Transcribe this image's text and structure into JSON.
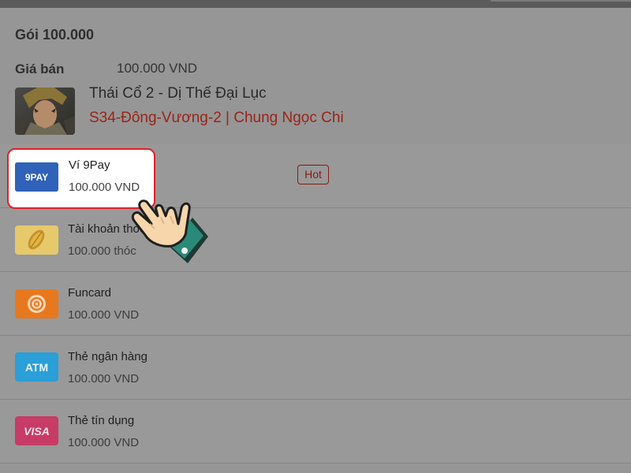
{
  "package": {
    "title": "Gói 100.000",
    "price_label": "Giá bán",
    "price_value": "100.000 VND"
  },
  "game": {
    "name": "Thái Cổ 2 - Dị Thế Đại Lục",
    "server": "S34-Đông-Vương-2 | Chung Ngọc Chi"
  },
  "methods": [
    {
      "name": "Ví 9Pay",
      "amount": "100.000 VND",
      "icon": "9pay-logo-icon",
      "logo_text": "9PAY",
      "badge": "Hot",
      "highlighted": true
    },
    {
      "name": "Tài khoản thóc",
      "amount": "100.000 thóc",
      "icon": "rice-grain-icon"
    },
    {
      "name": "Funcard",
      "amount": "100.000 VND",
      "icon": "funcard-swirl-icon"
    },
    {
      "name": "Thẻ ngân hàng",
      "amount": "100.000 VND",
      "icon": "atm-card-icon",
      "logo_text": "ATM"
    },
    {
      "name": "Thẻ tín dụng",
      "amount": "100.000 VND",
      "icon": "visa-card-icon",
      "logo_text": "VISA"
    }
  ],
  "colors": {
    "highlight_border": "#e0202a",
    "server_text": "#9a2418",
    "hot_badge": "#8b1a10",
    "pay9_blue": "#2f62b8",
    "funcard_orange": "#e8781e",
    "atm_blue": "#2a9fd8",
    "visa_pink": "#d2406a",
    "thoc_gold": "#e6c050"
  }
}
